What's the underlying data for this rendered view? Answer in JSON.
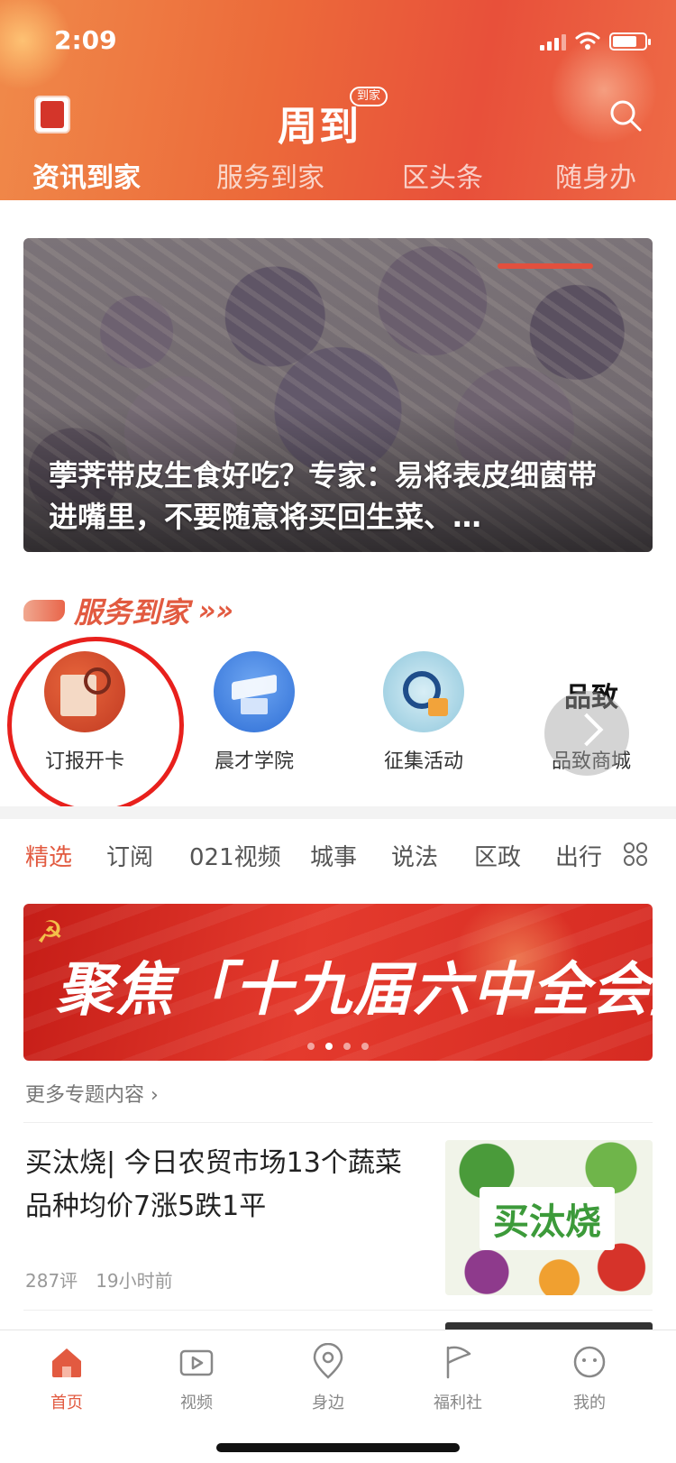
{
  "status_bar": {
    "time": "2:09"
  },
  "header": {
    "logo_text": "周到",
    "logo_badge": "到家",
    "tabs": [
      {
        "label": "资讯到家",
        "active": true
      },
      {
        "label": "服务到家",
        "active": false
      },
      {
        "label": "区头条",
        "active": false
      },
      {
        "label": "随身办",
        "active": false
      }
    ]
  },
  "hero": {
    "title": "荸荠带皮生食好吃？专家：易将表皮细菌带进嘴里，不要随意将买回生菜、…"
  },
  "services": {
    "title": "服务到家",
    "more_arrows": "»»",
    "items": [
      {
        "label": "订报开卡",
        "icon": "newspaper-card-icon"
      },
      {
        "label": "晨才学院",
        "icon": "graduation-cap-icon"
      },
      {
        "label": "征集活动",
        "icon": "magnifier-collect-icon"
      },
      {
        "label": "品致商城",
        "icon": "pinzhi-mall-logo",
        "logo_text": "品致"
      }
    ]
  },
  "channels": {
    "tabs": [
      {
        "label": "精选",
        "active": true
      },
      {
        "label": "订阅",
        "active": false
      },
      {
        "label": "021视频",
        "active": false
      },
      {
        "label": "城事",
        "active": false
      },
      {
        "label": "说法",
        "active": false
      },
      {
        "label": "区政",
        "active": false
      },
      {
        "label": "出行",
        "active": false
      }
    ]
  },
  "topic_banner": {
    "text": "聚焦「十九届六中全会」"
  },
  "more_topics": "更多专题内容 ›",
  "news": [
    {
      "title": "买汰烧| 今日农贸市场13个蔬菜品种均价7涨5跌1平",
      "comments": "287评",
      "time": "19小时前",
      "thumb_label": "买汰烧"
    }
  ],
  "bottom_nav": [
    {
      "label": "首页",
      "icon": "home-icon",
      "active": true
    },
    {
      "label": "视频",
      "icon": "video-icon",
      "active": false
    },
    {
      "label": "身边",
      "icon": "location-pin-icon",
      "active": false
    },
    {
      "label": "福利社",
      "icon": "flag-icon",
      "active": false
    },
    {
      "label": "我的",
      "icon": "profile-face-icon",
      "active": false
    }
  ],
  "colors": {
    "accent": "#e25a40",
    "header_start": "#f08a4a",
    "header_end": "#e8503a",
    "highlight_circle": "#e8201c"
  }
}
